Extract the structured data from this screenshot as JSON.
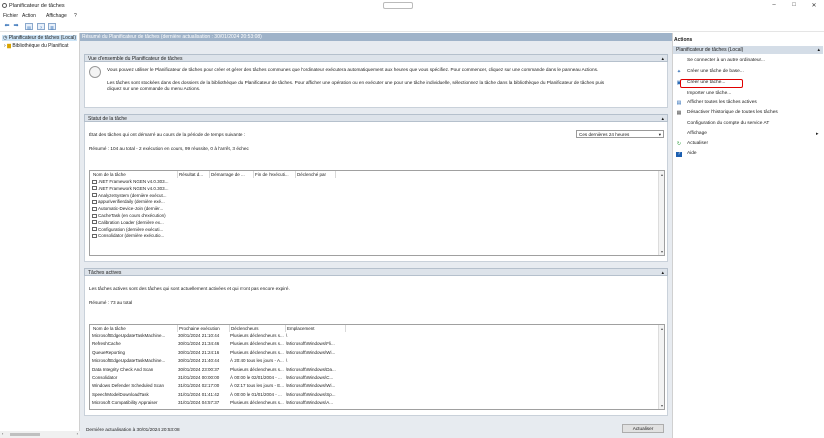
{
  "window": {
    "title": "Planificateur de tâches",
    "controls": [
      "–",
      "□",
      "✕"
    ]
  },
  "menu": [
    "Fichier",
    "Action",
    "Affichage",
    "?"
  ],
  "tree": [
    {
      "label": "Planificateur de tâches (Local)",
      "selected": true
    },
    {
      "label": "Bibliothèque du Planificat",
      "selected": false
    }
  ],
  "center": {
    "header": "Résumé du Planificateur de tâches (dernière actualisation : 30/01/2024 20:53:08)",
    "overview": {
      "title": "Vue d'ensemble du Planificateur de tâches",
      "para1": "Vous pouvez utiliser le Planificateur de tâches pour créer et gérer des tâches communes que l'ordinateur exécutera automatiquement aux heures que vous spécifiez. Pour commencer, cliquez sur une commande dans le panneau Actions.",
      "para2_l1": "Les tâches sont stockées dans des dossiers de la bibliothèque du Planificateur de tâches. Pour afficher une opération ou en exécuter une pour une tâche individuelle, sélectionnez la tâche dans la bibliothèque du Planificateur de tâches puis",
      "para2_l2": "cliquez sur une commande du menu Actions."
    },
    "status": {
      "title": "Statut de la tâche",
      "label": "État des tâches qui ont démarré au cours de la période de temps suivante :",
      "period": "Ces dernières 24 heures",
      "summary": "Résumé : 104 au total - 2 exécution en cours, 99 réussite, 0 à l'arrêt, 3 échec",
      "columns": [
        "Nom de la tâche",
        "Résultat d...",
        "Démarrage de ...",
        "Fin de l'exécuti...",
        "Déclenché par"
      ],
      "rows": [
        ".NET Framework NGEN v4.0.303...",
        ".NET Framework NGEN v4.0.303...",
        "AnalyzeSystem (dernière exécut...",
        "appuriverifierdaily (dernière exé...",
        "Automatic-Device-Join (dernièr...",
        "CacheTask (en cours d'exécution)",
        "Calibration Loader (dernière ex...",
        "Configuration (dernière exécuti...",
        "Consolidator (dernière exécutio..."
      ]
    },
    "active": {
      "title": "Tâches actives",
      "desc": "Les tâches actives sont des tâches qui sont actuellement activées et qui n'ont pas encore expiré.",
      "summary": "Résumé : 73 au total",
      "columns": [
        "Nom de la tâche",
        "Prochaine exécution",
        "Déclencheurs",
        "Emplacement"
      ],
      "rows": [
        [
          "MicrosoftEdgeUpdateTaskMachine...",
          "30/01/2024 21:10:44",
          "Plusieurs déclencheurs s...",
          "\\"
        ],
        [
          "RefreshCache",
          "30/01/2024 21:34:46",
          "Plusieurs déclencheurs s...",
          "\\Microsoft\\Windows\\Fli..."
        ],
        [
          "QueueReporting",
          "30/01/2024 21:24:16",
          "Plusieurs déclencheurs s...",
          "\\Microsoft\\Windows\\Wi..."
        ],
        [
          "MicrosoftEdgeUpdateTaskMachine...",
          "30/01/2024 21:40:44",
          "À 20:40 tous les jours - A...",
          "\\"
        ],
        [
          "Data Integrity Check And Scan",
          "30/01/2024 23:00:37",
          "Plusieurs déclencheurs s...",
          "\\Microsoft\\Windows\\Da..."
        ],
        [
          "Consolidator",
          "31/01/2024 00:00:00",
          "À 00:00 le 02/01/2004 - ...",
          "\\Microsoft\\Windows\\C..."
        ],
        [
          "Windows Defender Scheduled Scan",
          "31/01/2024 02:17:00",
          "À 02:17 tous les jours - E...",
          "\\Microsoft\\Windows\\Wi..."
        ],
        [
          "SpeechModelDownloadTask",
          "31/01/2024 01:41:42",
          "À 00:00 le 01/01/2004 - ...",
          "\\Microsoft\\Windows\\Sp..."
        ],
        [
          "Microsoft Compatibility Appraiser",
          "31/01/2024 04:57:37",
          "Plusieurs déclencheurs s...",
          "\\Microsoft\\Windows\\A..."
        ]
      ]
    },
    "footer": "Dernière actualisation à 30/01/2024 20:53:08",
    "refresh_button": "Actualiser"
  },
  "actions": {
    "title": "Actions",
    "section": "Planificateur de tâches (Local)",
    "items": [
      {
        "label": "Se connecter à un autre ordinateur...",
        "icon": "none"
      },
      {
        "label": "Créer une tâche de base...",
        "icon": "wand-icon"
      },
      {
        "label": "Créer une tâche...",
        "icon": "new-task-icon"
      },
      {
        "label": "Importer une tâche...",
        "icon": "none"
      },
      {
        "label": "Afficher toutes les tâches actives",
        "icon": "list-icon"
      },
      {
        "label": "Désactiver l'historique de toutes les tâches",
        "icon": "history-icon"
      },
      {
        "label": "Configuration du compte du service AT",
        "icon": "none"
      },
      {
        "label": "Affichage",
        "icon": "none",
        "submenu": true
      },
      {
        "label": "Actualiser",
        "icon": "refresh-icon"
      },
      {
        "label": "Aide",
        "icon": "help-icon"
      }
    ]
  },
  "colors": {
    "highlight": "#e00000",
    "accent": "#2b6bb5"
  }
}
